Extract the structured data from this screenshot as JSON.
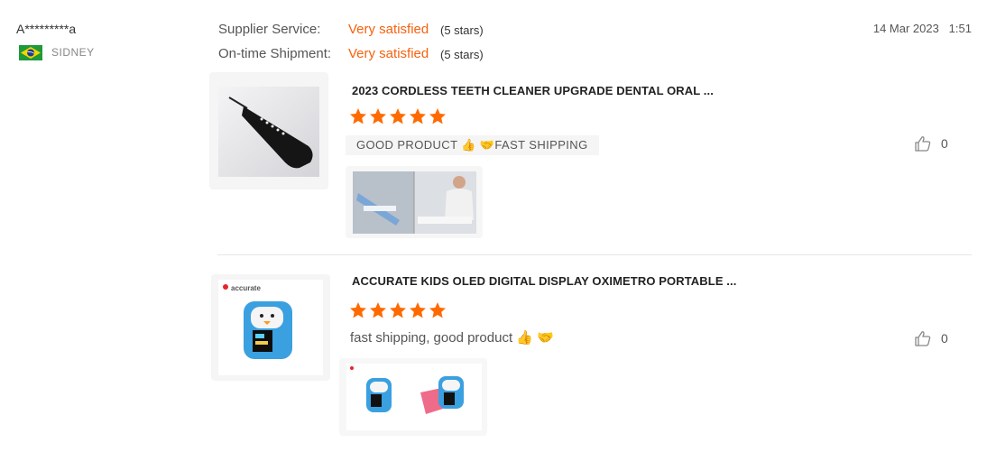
{
  "reviewer": {
    "name": "A*********a",
    "country": "SIDNEY"
  },
  "ratings": [
    {
      "label": "Supplier Service:",
      "value": "Very satisfied",
      "stars": "(5 stars)"
    },
    {
      "label": "On-time Shipment:",
      "value": "Very satisfied",
      "stars": "(5 stars)"
    }
  ],
  "date": "14 Mar 2023   1:51",
  "items": [
    {
      "title": "2023 CORDLESS TEETH CLEANER UPGRADE DENTAL ORAL ...",
      "rating": 5,
      "comment": "GOOD PRODUCT 👍 🤝FAST SHIPPING",
      "likes": "0"
    },
    {
      "title": "ACCURATE KIDS OLED DIGITAL DISPLAY OXIMETRO PORTABLE ...",
      "rating": 5,
      "comment": "fast shipping, good product 👍 🤝",
      "likes": "0",
      "brand": "accurate"
    }
  ],
  "colors": {
    "accent": "#f5620f",
    "star": "#ff6a00"
  }
}
